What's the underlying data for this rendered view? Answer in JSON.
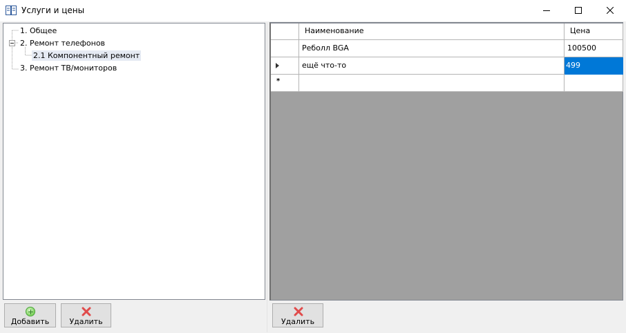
{
  "window": {
    "title": "Услуги и цены",
    "icon": "book-icon"
  },
  "tree": {
    "nodes": [
      {
        "label": "1. Общее"
      },
      {
        "label": "2. Ремонт телефонов"
      },
      {
        "label": "2.1 Компонентный ремонт"
      },
      {
        "label": "3. Ремонт ТВ/мониторов"
      }
    ]
  },
  "grid": {
    "columns": [
      "Наименование",
      "Цена"
    ],
    "rows": [
      {
        "name": "Реболл BGA",
        "price": "100500"
      },
      {
        "name": "ещё что-то",
        "price": "499"
      }
    ],
    "new_row_marker": "*"
  },
  "buttons": {
    "add": "Добавить",
    "delete_left": "Удалить",
    "delete_right": "Удалить"
  },
  "colors": {
    "selection": "#0078d7",
    "delete_icon": "#e04b4b",
    "add_icon": "#7fd35e"
  }
}
